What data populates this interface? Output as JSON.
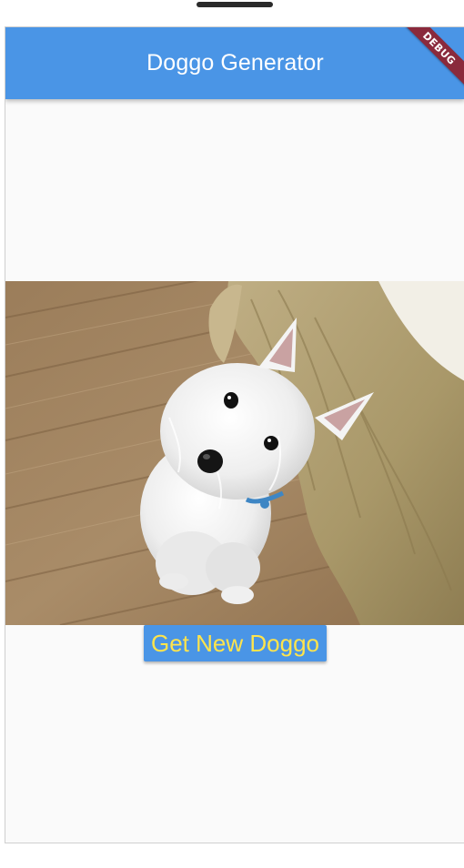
{
  "app_bar": {
    "title": "Doggo Generator",
    "color": "#4a95e6"
  },
  "debug_banner": {
    "label": "DEBUG",
    "color": "#8a2a3c"
  },
  "main": {
    "image_icon": "dog-photo",
    "button_label": "Get New Doggo",
    "button_text_color": "#ffe44c"
  }
}
